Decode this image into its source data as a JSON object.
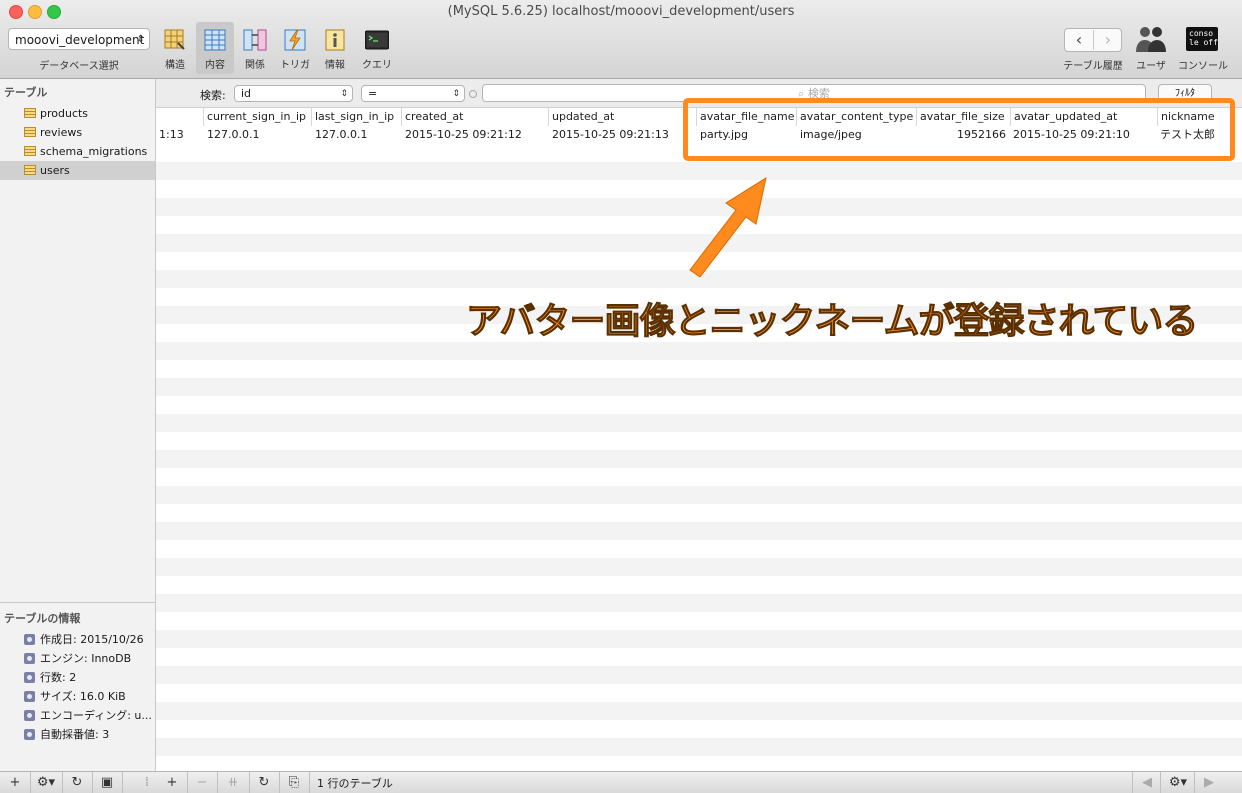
{
  "window": {
    "title": "(MySQL 5.6.25) localhost/mooovi_development/users"
  },
  "toolbar": {
    "db_select_value": "mooovi_development",
    "db_select_label": "データベース選択",
    "buttons": [
      {
        "label": "構造",
        "icon": "structure-icon"
      },
      {
        "label": "内容",
        "icon": "content-icon"
      },
      {
        "label": "関係",
        "icon": "relations-icon"
      },
      {
        "label": "トリガ",
        "icon": "triggers-icon"
      },
      {
        "label": "情報",
        "icon": "info-icon"
      },
      {
        "label": "クエリ",
        "icon": "query-icon"
      }
    ],
    "history_label": "テーブル履歴",
    "users_label": "ユーザ",
    "console_label": "コンソール",
    "console_icon_text": "conso le off"
  },
  "sidebar": {
    "tables_heading": "テーブル",
    "tables": [
      "products",
      "reviews",
      "schema_migrations",
      "users"
    ],
    "info_heading": "テーブルの情報",
    "info": [
      "作成日: 2015/10/26",
      "エンジン: InnoDB",
      "行数: 2",
      "サイズ: 16.0 KiB",
      "エンコーディング: u...",
      "自動採番値: 3"
    ]
  },
  "filter": {
    "label": "検索:",
    "field": "id",
    "operator": "=",
    "search_placeholder": "検索",
    "filter_button": "ﾌｨﾙﾀ"
  },
  "table": {
    "columns": [
      "",
      "current_sign_in_ip",
      "last_sign_in_ip",
      "created_at",
      "updated_at",
      "",
      "avatar_file_name",
      "avatar_content_type",
      "avatar_file_size",
      "avatar_updated_at",
      "nickname"
    ],
    "row": [
      "1:13",
      "127.0.0.1",
      "127.0.0.1",
      "2015-10-25 09:21:12",
      "2015-10-25 09:21:13",
      "",
      "party.jpg",
      "image/jpeg",
      "1952166",
      "2015-10-25 09:21:10",
      "テスト太郎"
    ]
  },
  "annotation": {
    "text": "アバター画像とニックネームが登録されている",
    "color": "#ff8b1f"
  },
  "status": {
    "text": "1 行のテーブル"
  }
}
